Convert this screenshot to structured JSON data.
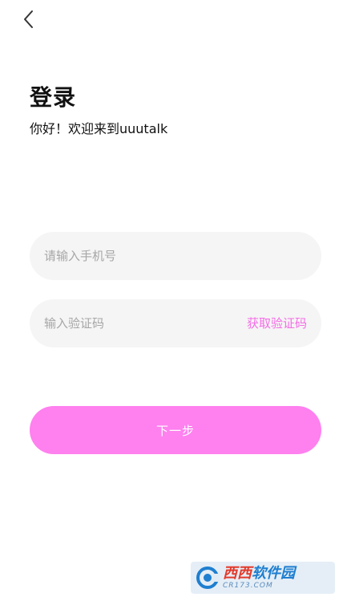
{
  "header": {
    "back_icon": "chevron-left-icon"
  },
  "login": {
    "title": "登录",
    "subtitle": "你好！欢迎来到uuutalk"
  },
  "phone_field": {
    "value": "",
    "placeholder": "请输入手机号"
  },
  "code_field": {
    "value": "",
    "placeholder": "输入验证码",
    "get_code_label": "获取验证码"
  },
  "next_button": {
    "label": "下一步"
  },
  "watermark": {
    "brand_red": "西西",
    "brand_blue": "软件园",
    "domain": "CR173.COM"
  },
  "colors": {
    "accent": "#ff80ef",
    "link": "#f46de6",
    "field_bg": "#f5f5f5"
  }
}
